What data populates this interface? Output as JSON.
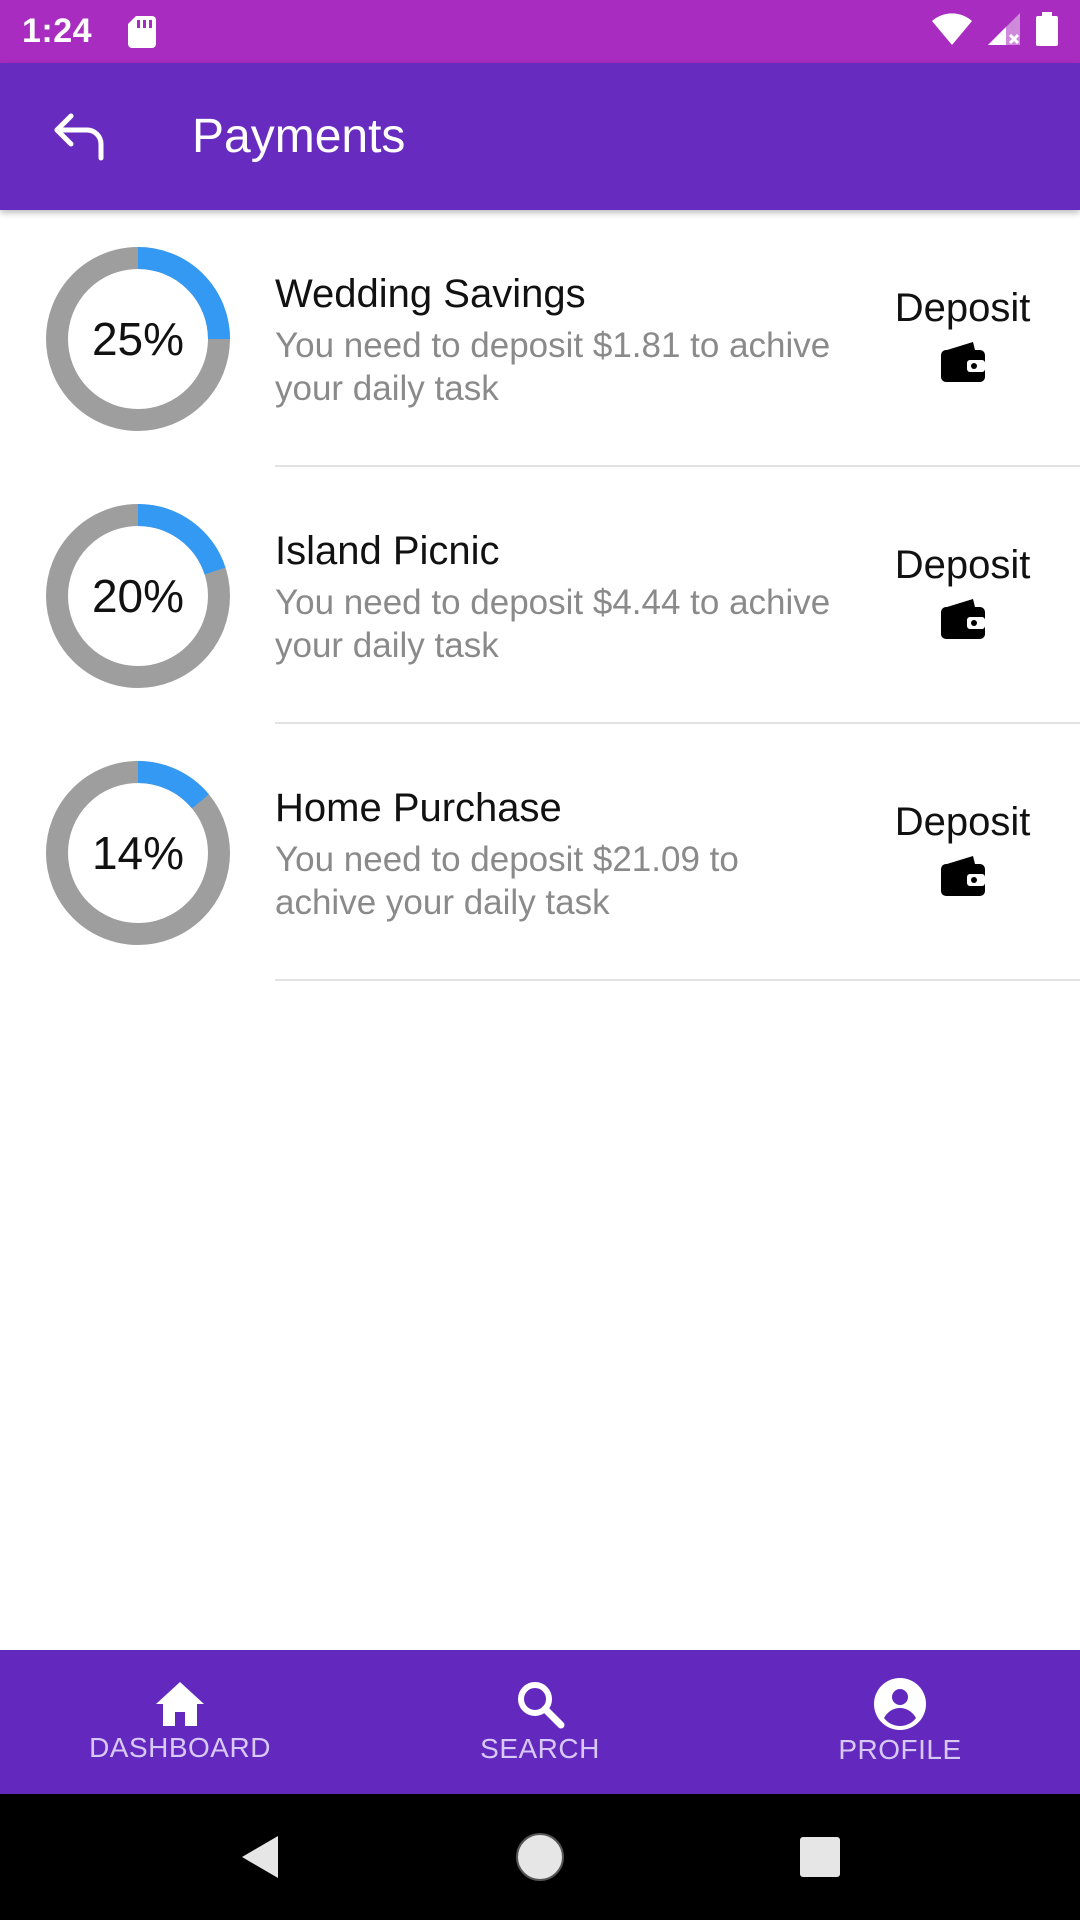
{
  "status_bar": {
    "time": "1:24"
  },
  "app_bar": {
    "title": "Payments"
  },
  "payments": [
    {
      "progress_label": "25%",
      "progress": 0.25,
      "title": "Wedding Savings",
      "description": "You need to deposit $1.81 to achive your daily task",
      "action_label": "Deposit"
    },
    {
      "progress_label": "20%",
      "progress": 0.2,
      "title": "Island Picnic",
      "description": "You need to deposit $4.44 to achive your daily task",
      "action_label": "Deposit"
    },
    {
      "progress_label": "14%",
      "progress": 0.14,
      "title": "Home Purchase",
      "description": "You need to deposit $21.09 to achive your daily task",
      "action_label": "Deposit"
    }
  ],
  "bottom_nav": [
    {
      "label": "DASHBOARD",
      "icon": "home-icon"
    },
    {
      "label": "SEARCH",
      "icon": "search-icon"
    },
    {
      "label": "PROFILE",
      "icon": "account-circle-icon"
    }
  ],
  "colors": {
    "status_bar": "#a72cbf",
    "app_bar": "#682bbf",
    "bottom_nav": "#6329bf",
    "progress_fill": "#3399f3",
    "progress_track": "#9e9e9e"
  }
}
